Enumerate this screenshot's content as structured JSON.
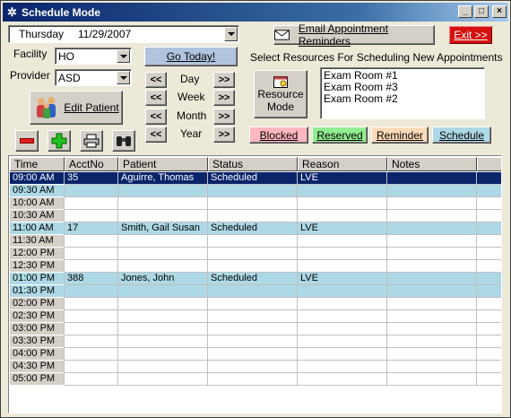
{
  "window": {
    "title": "Schedule Mode"
  },
  "date_combo": {
    "day": "Thursday",
    "date": "11/29/2007"
  },
  "facility": {
    "label": "Facility",
    "value": "HO"
  },
  "provider": {
    "label": "Provider",
    "value": "ASD"
  },
  "go_today": "Go Today!",
  "edit_patient": "Edit Patient",
  "nav": {
    "prev": "<<",
    "next": ">>",
    "periods": [
      "Day",
      "Week",
      "Month",
      "Year"
    ]
  },
  "resource_mode": {
    "line1": "Resource",
    "line2": "Mode"
  },
  "email_reminders": "Email Appointment Reminders",
  "exit": "Exit >>",
  "resources_label": "Select Resources For Scheduling New Appointments",
  "resources": [
    "Exam Room #1",
    "Exam Room #3",
    "Exam Room #2"
  ],
  "legend": {
    "blocked": {
      "label": "Blocked",
      "color": "#ffb6c1"
    },
    "reserved": {
      "label": "Reserved",
      "color": "#90ee90"
    },
    "reminder": {
      "label": "Reminder",
      "color": "#ffdab9"
    },
    "schedule": {
      "label": "Schedule",
      "color": "#add8e6"
    }
  },
  "grid": {
    "columns": [
      "Time",
      "AcctNo",
      "Patient",
      "Status",
      "Reason",
      "Notes"
    ],
    "rows": [
      {
        "time": "09:00 AM",
        "acct": "35",
        "patient": "Aguirre, Thomas",
        "status": "Scheduled",
        "reason": "LVE",
        "notes": "",
        "state": "selected"
      },
      {
        "time": "09:30 AM",
        "acct": "",
        "patient": "",
        "status": "",
        "reason": "",
        "notes": "",
        "state": "booked"
      },
      {
        "time": "10:00 AM",
        "acct": "",
        "patient": "",
        "status": "",
        "reason": "",
        "notes": "",
        "state": ""
      },
      {
        "time": "10:30 AM",
        "acct": "",
        "patient": "",
        "status": "",
        "reason": "",
        "notes": "",
        "state": ""
      },
      {
        "time": "11:00 AM",
        "acct": "17",
        "patient": "Smith, Gail Susan",
        "status": "Scheduled",
        "reason": "LVE",
        "notes": "",
        "state": "booked"
      },
      {
        "time": "11:30 AM",
        "acct": "",
        "patient": "",
        "status": "",
        "reason": "",
        "notes": "",
        "state": ""
      },
      {
        "time": "12:00 PM",
        "acct": "",
        "patient": "",
        "status": "",
        "reason": "",
        "notes": "",
        "state": ""
      },
      {
        "time": "12:30 PM",
        "acct": "",
        "patient": "",
        "status": "",
        "reason": "",
        "notes": "",
        "state": ""
      },
      {
        "time": "01:00 PM",
        "acct": "388",
        "patient": "Jones, John",
        "status": "Scheduled",
        "reason": "LVE",
        "notes": "",
        "state": "booked"
      },
      {
        "time": "01:30 PM",
        "acct": "",
        "patient": "",
        "status": "",
        "reason": "",
        "notes": "",
        "state": "booked"
      },
      {
        "time": "02:00 PM",
        "acct": "",
        "patient": "",
        "status": "",
        "reason": "",
        "notes": "",
        "state": ""
      },
      {
        "time": "02:30 PM",
        "acct": "",
        "patient": "",
        "status": "",
        "reason": "",
        "notes": "",
        "state": ""
      },
      {
        "time": "03:00 PM",
        "acct": "",
        "patient": "",
        "status": "",
        "reason": "",
        "notes": "",
        "state": ""
      },
      {
        "time": "03:30 PM",
        "acct": "",
        "patient": "",
        "status": "",
        "reason": "",
        "notes": "",
        "state": ""
      },
      {
        "time": "04:00 PM",
        "acct": "",
        "patient": "",
        "status": "",
        "reason": "",
        "notes": "",
        "state": ""
      },
      {
        "time": "04:30 PM",
        "acct": "",
        "patient": "",
        "status": "",
        "reason": "",
        "notes": "",
        "state": ""
      },
      {
        "time": "05:00 PM",
        "acct": "",
        "patient": "",
        "status": "",
        "reason": "",
        "notes": "",
        "state": ""
      }
    ]
  }
}
